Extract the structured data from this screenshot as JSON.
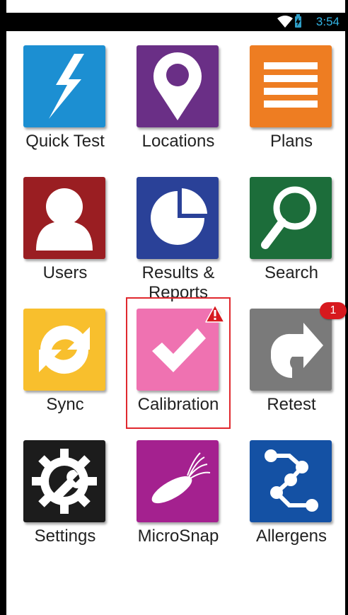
{
  "status_bar": {
    "time": "3:54",
    "wifi_icon": "wifi-icon",
    "battery_icon": "battery-charging-icon"
  },
  "tiles": [
    {
      "label": "Quick Test",
      "color": "#1c8fd2",
      "icon": "lightning-icon"
    },
    {
      "label": "Locations",
      "color": "#6a2f86",
      "icon": "map-pin-icon"
    },
    {
      "label": "Plans",
      "color": "#ee7d22",
      "icon": "list-lines-icon"
    },
    {
      "label": "Users",
      "color": "#9a1e22",
      "icon": "person-icon"
    },
    {
      "label": "Results &\nReports",
      "color": "#2a4198",
      "icon": "pie-chart-icon"
    },
    {
      "label": "Search",
      "color": "#1c6d3a",
      "icon": "magnifier-icon"
    },
    {
      "label": "Sync",
      "color": "#f8bf2d",
      "icon": "sync-arrows-icon"
    },
    {
      "label": "Calibration",
      "color": "#ef72b1",
      "icon": "checkmark-icon"
    },
    {
      "label": "Retest",
      "color": "#7a7a7a",
      "icon": "retest-arrow-icon"
    },
    {
      "label": "Settings",
      "color": "#1c1c1c",
      "icon": "gear-wrench-icon"
    },
    {
      "label": "MicroSnap",
      "color": "#a4218f",
      "icon": "bacteria-icon"
    },
    {
      "label": "Allergens",
      "color": "#1451a4",
      "icon": "molecule-chain-icon"
    }
  ],
  "badges": {
    "calibration_warning_icon": "warning-icon",
    "retest_count": "1"
  },
  "highlight_color": "#e0282e"
}
